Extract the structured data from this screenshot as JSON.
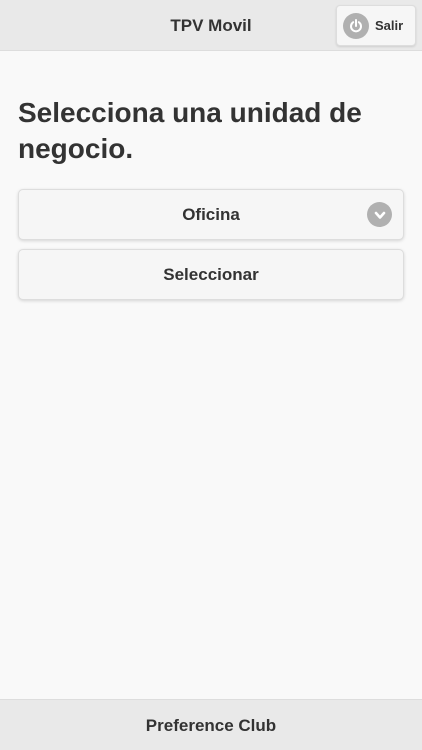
{
  "header": {
    "title": "TPV Movil",
    "logout_label": "Salir",
    "logout_icon": "power-icon"
  },
  "main": {
    "title": "Selecciona una unidad de negocio.",
    "business_unit_select": {
      "selected": "Oficina",
      "icon": "chevron-down-icon"
    },
    "submit_label": "Seleccionar"
  },
  "footer": {
    "text": "Preference Club"
  },
  "colors": {
    "header_bg": "#e9e9e9",
    "page_bg": "#f9f9f9",
    "button_bg": "#f6f6f6",
    "icon_disc": "#b0b0b0",
    "text": "#333333"
  }
}
